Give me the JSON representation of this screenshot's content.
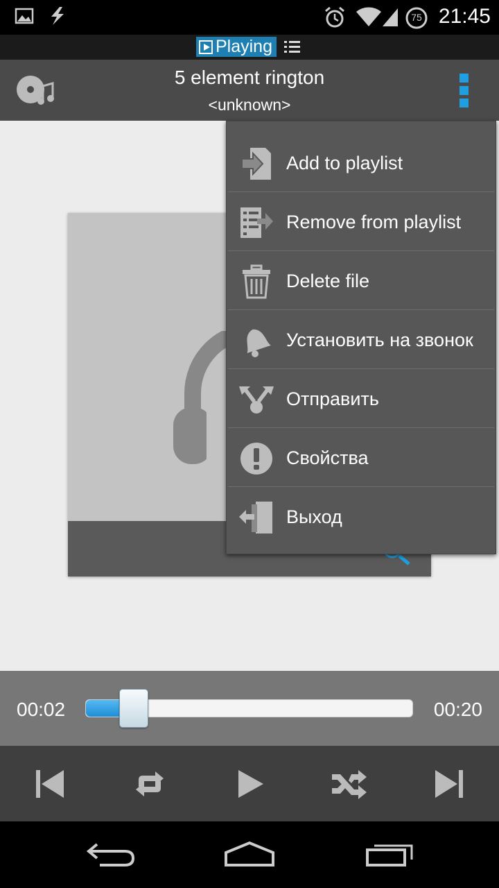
{
  "status_bar": {
    "time": "21:45",
    "battery_level": "75",
    "icons": [
      "image-notification-icon",
      "flash-notification-icon",
      "alarm-icon",
      "wifi-icon",
      "signal-icon",
      "battery-icon"
    ]
  },
  "tab_strip": {
    "playing_label": "Playing",
    "list_icon": "list-icon"
  },
  "header": {
    "title": "5 element rington",
    "artist": "<unknown>"
  },
  "menu": {
    "items": [
      {
        "label": "Add to playlist",
        "icon": "add-to-playlist-icon"
      },
      {
        "label": "Remove from playlist",
        "icon": "remove-from-playlist-icon"
      },
      {
        "label": "Delete file",
        "icon": "trash-icon"
      },
      {
        "label": "Установить на звонок",
        "icon": "bell-icon"
      },
      {
        "label": "Отправить",
        "icon": "share-icon"
      },
      {
        "label": "Свойства",
        "icon": "info-icon"
      },
      {
        "label": "Выход",
        "icon": "exit-icon"
      }
    ]
  },
  "player": {
    "current_time": "00:02",
    "total_time": "00:20",
    "progress_fraction": 0.1
  },
  "colors": {
    "accent": "#1f9fe0",
    "header_bg": "#4a4a4a",
    "menu_bg": "#575757",
    "content_bg": "#ececec"
  }
}
